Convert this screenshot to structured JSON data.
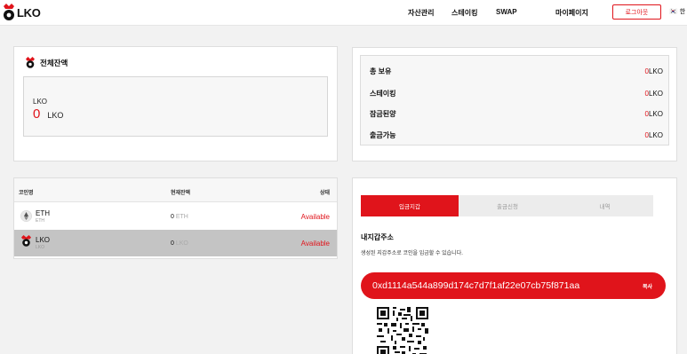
{
  "header": {
    "logo_text": "LKO",
    "nav": [
      "자산관리",
      "스테이킹",
      "SWAP",
      "마이페이지"
    ],
    "logout_label": "로그아웃",
    "lang_flag": "🇰🇷",
    "lang_label": "한"
  },
  "balance": {
    "title": "전체잔액",
    "label": "LKO",
    "value": "0",
    "unit": "LKO"
  },
  "summary": {
    "rows": [
      {
        "label": "총 보유",
        "value": "0",
        "unit": "LKO"
      },
      {
        "label": "스테이킹",
        "value": "0",
        "unit": "LKO"
      },
      {
        "label": "잠금된양",
        "value": "0",
        "unit": "LKO"
      },
      {
        "label": "출금가능",
        "value": "0",
        "unit": "LKO"
      }
    ]
  },
  "coins": {
    "headers": {
      "name": "코인명",
      "balance": "현재잔액",
      "status": "상태"
    },
    "rows": [
      {
        "name": "ETH",
        "symbol": "ETH",
        "balance": "0",
        "unit": "ETH",
        "status": "Available",
        "icon": "ethereum-icon"
      },
      {
        "name": "LKO",
        "symbol": "LKO",
        "balance": "0",
        "unit": "LKO",
        "status": "Available",
        "icon": "lko-coin-icon"
      }
    ]
  },
  "deposit": {
    "tabs": [
      "입금지갑",
      "출금신청",
      "내역"
    ],
    "title": "내지갑주소",
    "description": "생성된 지갑주소로 코인을 입금할 수 있습니다.",
    "address": "0xd1114a544a899d174c7d7f1af22e07cb75f871aa",
    "copy_label": "복사"
  },
  "colors": {
    "accent": "#e0141b",
    "panel": "#ffffff",
    "background": "#f2f2f2"
  }
}
